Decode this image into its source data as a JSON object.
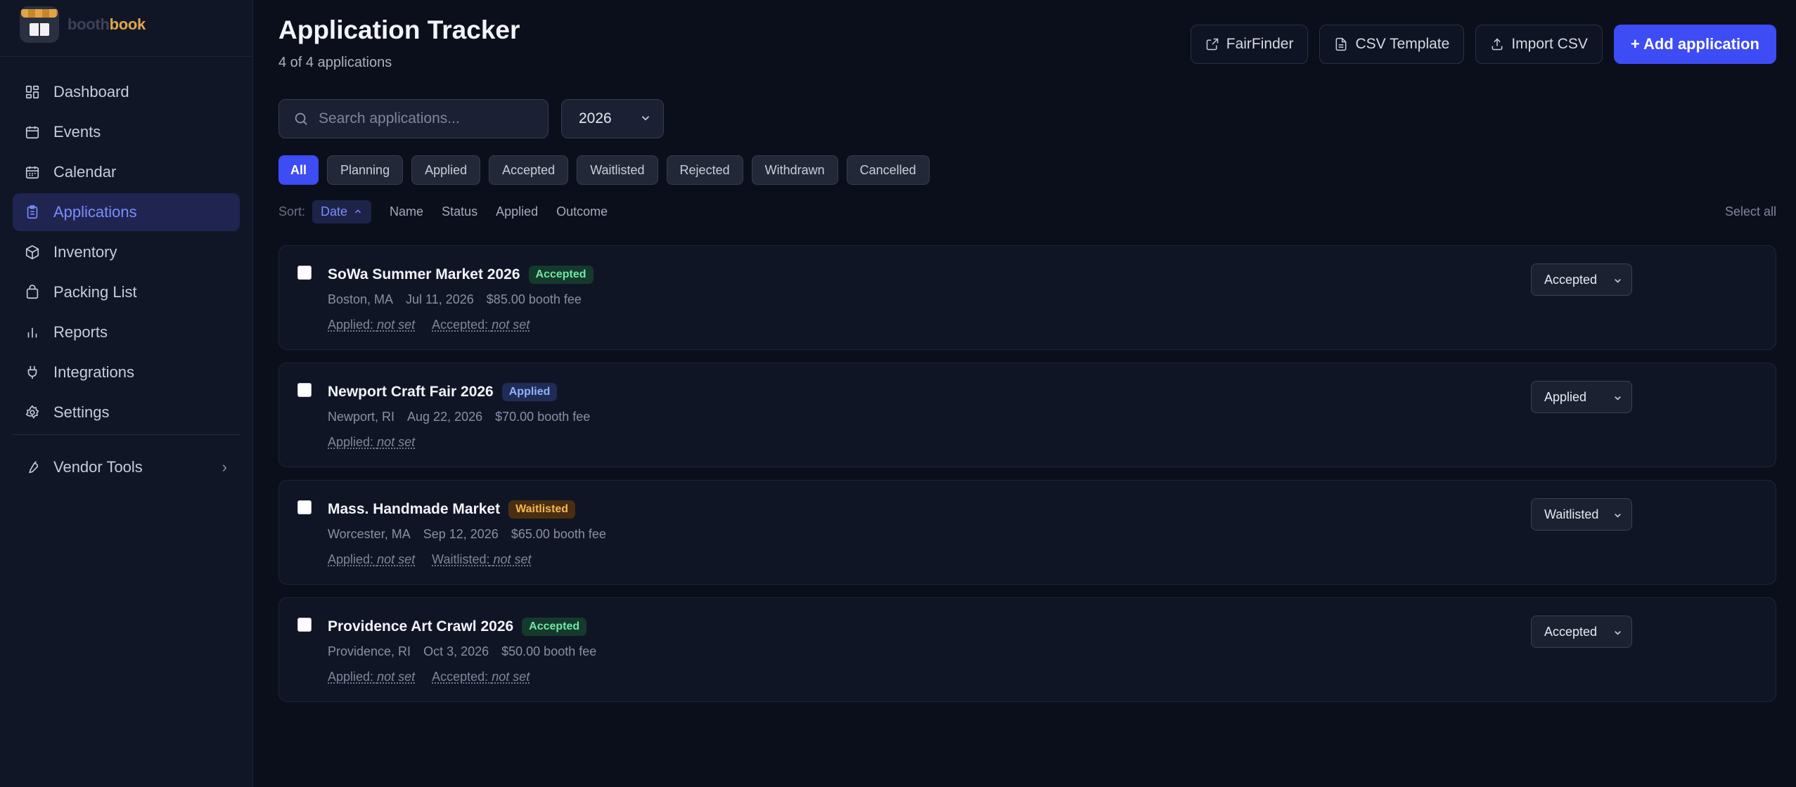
{
  "brand": {
    "name_part1": "booth",
    "name_part2": "book"
  },
  "sidebar": {
    "items": [
      {
        "label": "Dashboard",
        "icon": "dashboard-icon"
      },
      {
        "label": "Events",
        "icon": "calendar-icon"
      },
      {
        "label": "Calendar",
        "icon": "calendar-icon"
      },
      {
        "label": "Applications",
        "icon": "clipboard-icon",
        "active": true
      },
      {
        "label": "Inventory",
        "icon": "box-icon"
      },
      {
        "label": "Packing List",
        "icon": "bag-icon"
      },
      {
        "label": "Reports",
        "icon": "bar-chart-icon"
      },
      {
        "label": "Integrations",
        "icon": "plug-icon"
      },
      {
        "label": "Settings",
        "icon": "gear-icon"
      }
    ],
    "vendor_tools": {
      "label": "Vendor Tools",
      "icon": "wrench-icon"
    }
  },
  "header": {
    "title": "Application Tracker",
    "subtitle": "4 of 4 applications",
    "actions": {
      "fairfinder": "FairFinder",
      "csv_template": "CSV Template",
      "import_csv": "Import CSV",
      "add": "+ Add application"
    }
  },
  "search": {
    "placeholder": "Search applications..."
  },
  "year_filter": {
    "value": "2026"
  },
  "filters": [
    "All",
    "Planning",
    "Applied",
    "Accepted",
    "Waitlisted",
    "Rejected",
    "Withdrawn",
    "Cancelled"
  ],
  "sort": {
    "label": "Sort:",
    "options": [
      "Date",
      "Name",
      "Status",
      "Applied",
      "Outcome"
    ],
    "active": "Date",
    "select_all": "Select all"
  },
  "applications": [
    {
      "name": "SoWa Summer Market 2026",
      "badge": "Accepted",
      "location": "Boston, MA",
      "date": "Jul 11, 2026",
      "fee": "$85.00 booth fee",
      "dates": [
        {
          "label": "Applied:",
          "value": "not set"
        },
        {
          "label": "Accepted:",
          "value": "not set"
        }
      ],
      "status": "Accepted"
    },
    {
      "name": "Newport Craft Fair 2026",
      "badge": "Applied",
      "location": "Newport, RI",
      "date": "Aug 22, 2026",
      "fee": "$70.00 booth fee",
      "dates": [
        {
          "label": "Applied:",
          "value": "not set"
        }
      ],
      "status": "Applied"
    },
    {
      "name": "Mass. Handmade Market",
      "badge": "Waitlisted",
      "location": "Worcester, MA",
      "date": "Sep 12, 2026",
      "fee": "$65.00 booth fee",
      "dates": [
        {
          "label": "Applied:",
          "value": "not set"
        },
        {
          "label": "Waitlisted:",
          "value": "not set"
        }
      ],
      "status": "Waitlisted"
    },
    {
      "name": "Providence Art Crawl 2026",
      "badge": "Accepted",
      "location": "Providence, RI",
      "date": "Oct 3, 2026",
      "fee": "$50.00 booth fee",
      "dates": [
        {
          "label": "Applied:",
          "value": "not set"
        },
        {
          "label": "Accepted:",
          "value": "not set"
        }
      ],
      "status": "Accepted"
    }
  ],
  "colors": {
    "accent": "#3d4cf5",
    "active_nav_text": "#7b8cff",
    "brand_orange": "#e0a54a",
    "accepted": "#6ee7a8",
    "applied": "#8fb4ff",
    "waitlisted": "#f5b64f"
  }
}
